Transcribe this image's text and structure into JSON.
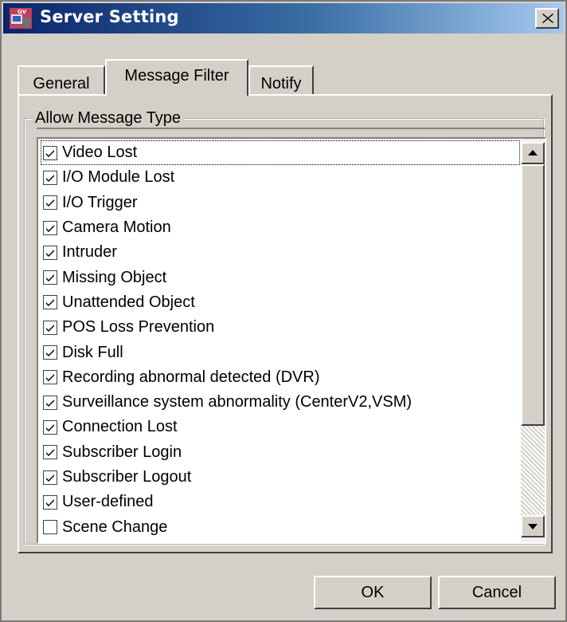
{
  "window": {
    "title": "Server Setting",
    "app_icon": "gv-server-app-icon",
    "close_icon": "close-icon"
  },
  "tabs": [
    {
      "label": "General",
      "selected": false
    },
    {
      "label": "Message Filter",
      "selected": true
    },
    {
      "label": "Notify",
      "selected": false
    }
  ],
  "group": {
    "legend": "Allow Message Type"
  },
  "message_types": [
    {
      "label": "Video Lost",
      "checked": true
    },
    {
      "label": "I/O Module Lost",
      "checked": true
    },
    {
      "label": "I/O Trigger",
      "checked": true
    },
    {
      "label": "Camera Motion",
      "checked": true
    },
    {
      "label": "Intruder",
      "checked": true
    },
    {
      "label": "Missing Object",
      "checked": true
    },
    {
      "label": "Unattended Object",
      "checked": true
    },
    {
      "label": "POS Loss Prevention",
      "checked": true
    },
    {
      "label": "Disk Full",
      "checked": true
    },
    {
      "label": "Recording abnormal detected (DVR)",
      "checked": true
    },
    {
      "label": "Surveillance system abnormality (CenterV2,VSM)",
      "checked": true
    },
    {
      "label": "Connection Lost",
      "checked": true
    },
    {
      "label": "Subscriber Login",
      "checked": true
    },
    {
      "label": "Subscriber Logout",
      "checked": true
    },
    {
      "label": "User-defined",
      "checked": true
    },
    {
      "label": "Scene Change",
      "checked": false
    }
  ],
  "buttons": {
    "ok": "OK",
    "cancel": "Cancel"
  },
  "icons": {
    "scroll_up": "arrow-up-icon",
    "scroll_down": "arrow-down-icon",
    "checkmark": "checkmark-icon"
  },
  "colors": {
    "title_gradient_start": "#0a246a",
    "title_gradient_end": "#a6caf0",
    "face": "#d4d0c8"
  }
}
